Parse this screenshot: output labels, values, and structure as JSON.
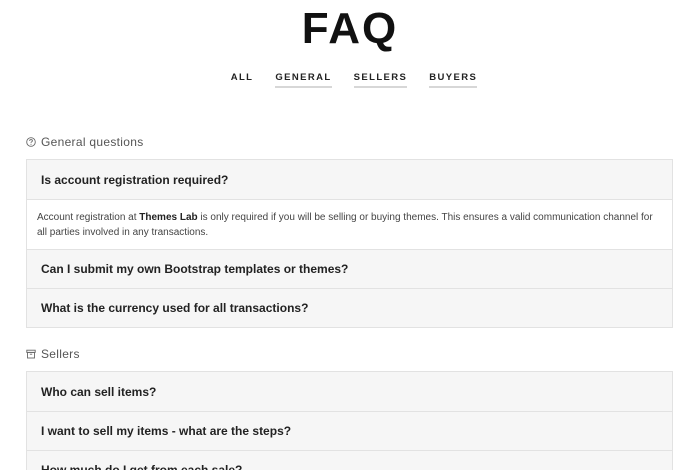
{
  "page": {
    "title": "FAQ"
  },
  "filters": [
    {
      "label": "ALL"
    },
    {
      "label": "GENERAL"
    },
    {
      "label": "SELLERS"
    },
    {
      "label": "BUYERS"
    }
  ],
  "sections": {
    "general": {
      "heading": "General questions",
      "icon": "question-circle-icon",
      "questions": [
        {
          "q": "Is account registration required?"
        },
        {
          "q": "Can I submit my own Bootstrap templates or themes?"
        },
        {
          "q": "What is the currency used for all transactions?"
        }
      ],
      "answer": {
        "prefix": "Account registration at ",
        "brand": "Themes Lab",
        "suffix": " is only required if you will be selling or buying themes. This ensures a valid communication channel for all parties involved in any transactions."
      }
    },
    "sellers": {
      "heading": "Sellers",
      "icon": "archive-box-icon",
      "questions": [
        {
          "q": "Who can sell items?"
        },
        {
          "q": "I want to sell my items - what are the steps?"
        },
        {
          "q": "How much do I get from each sale?"
        }
      ]
    }
  }
}
